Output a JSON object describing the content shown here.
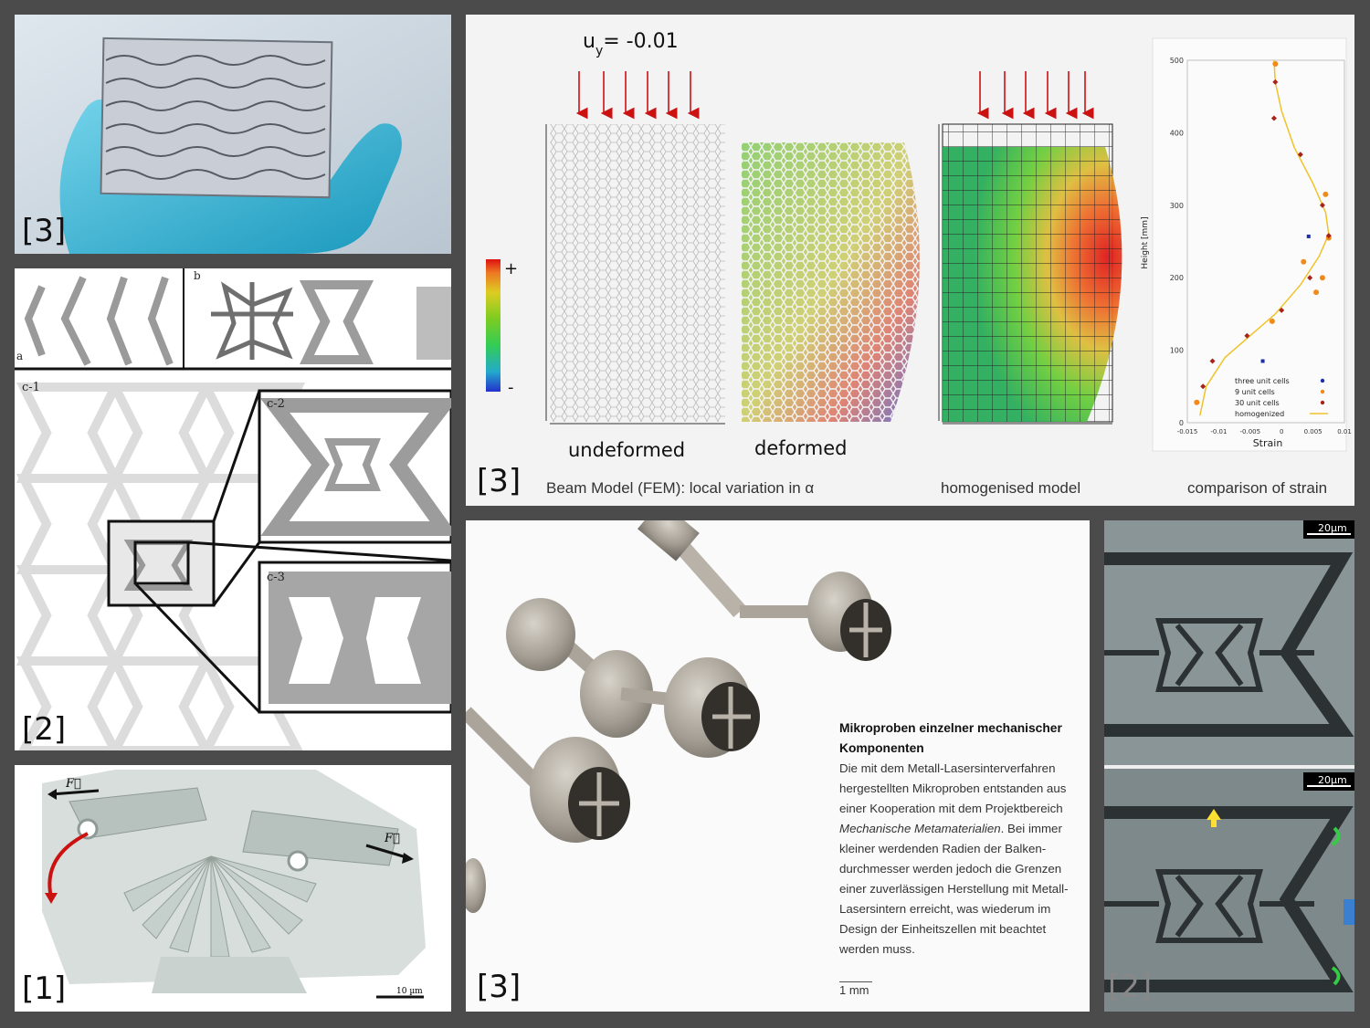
{
  "panels": {
    "photo_top_left": {
      "ref": "[3]"
    },
    "cells_figure": {
      "ref": "[2]",
      "sub_a": "a",
      "sub_b": "b",
      "sub_c1": "c-1",
      "sub_c2": "c-2",
      "sub_c3": "c-3"
    },
    "hinge_render": {
      "ref": "[1]",
      "force_left": "F⃗",
      "force_right": "F⃗",
      "scale_bar": "10 µm"
    },
    "fem": {
      "ref": "[3]",
      "load_label": "uy= -0.01",
      "load_sub": "y",
      "scale_plus": "+",
      "scale_minus": "-",
      "label_undeformed": "undeformed",
      "label_deformed": "deformed",
      "caption_beam": "Beam Model (FEM): local variation in α",
      "caption_homog": "homogenised model",
      "caption_strain": "comparison of strain",
      "plot": {
        "ylabel": "Height [mm]",
        "xlabel": "Strain",
        "yticks": [
          "0",
          "100",
          "200",
          "300",
          "400",
          "500"
        ],
        "xticks": [
          "-0.015",
          "-0.01",
          "-0.005",
          "0",
          "0.005",
          "0.01"
        ],
        "legend": [
          "three unit cells",
          "9 unit cells",
          "30 unit cells",
          "homogenized"
        ]
      }
    },
    "samples": {
      "ref": "[3]",
      "title": "Mikroproben einzelner mechanischer Komponenten",
      "body_1": "Die mit dem Metall-Lasersinterverfahren hergestellten Mikroproben entstanden aus einer Kooperation mit dem Projektbereich ",
      "body_italic": "Mechanische Metamaterialien",
      "body_2": ". Bei immer kleiner werdenden Radien der Balken-durchmesser werden jedoch die Grenzen einer zuverlässigen Herstellung mit Metall-Lasersintern erreicht, was wiederum im Design der Einheitszellen mit beachtet werden muss.",
      "scale": "1 mm"
    },
    "micrographs": {
      "ref": "[2]",
      "scale_top": "20µm",
      "scale_bottom": "20µm"
    }
  },
  "colors": {
    "background": "#4b4b4b",
    "arrow_red": "#cc1111",
    "glove_blue": "#3bb8d6",
    "cell_grey": "#a6a6a6"
  },
  "chart_data": {
    "type": "scatter",
    "xlabel": "Strain",
    "ylabel": "Height [mm]",
    "xlim": [
      -0.015,
      0.01
    ],
    "ylim": [
      0,
      500
    ],
    "series": [
      {
        "name": "three unit cells",
        "x": [
          -0.003,
          0.0043
        ],
        "y": [
          85,
          257
        ]
      },
      {
        "name": "9 unit cells",
        "x": [
          -0.0135,
          -0.0015,
          0.0035,
          0.007,
          0.0075,
          0.0065,
          0.0055,
          -0.001
        ],
        "y": [
          28,
          140,
          222,
          315,
          255,
          200,
          180,
          495
        ]
      },
      {
        "name": "30 unit cells",
        "x": [
          -0.0125,
          -0.011,
          -0.0055,
          0.0,
          0.0045,
          0.0075,
          0.0065,
          0.003,
          -0.0012,
          -0.001
        ],
        "y": [
          50,
          85,
          120,
          155,
          200,
          258,
          300,
          370,
          420,
          470
        ]
      },
      {
        "name": "homogenized",
        "x": [
          -0.013,
          -0.012,
          -0.009,
          -0.005,
          -0.001,
          0.003,
          0.006,
          0.0075,
          0.007,
          0.005,
          0.002,
          0.0,
          -0.001,
          -0.0012
        ],
        "y": [
          10,
          50,
          90,
          120,
          150,
          190,
          230,
          260,
          290,
          330,
          380,
          430,
          470,
          500
        ]
      }
    ]
  }
}
